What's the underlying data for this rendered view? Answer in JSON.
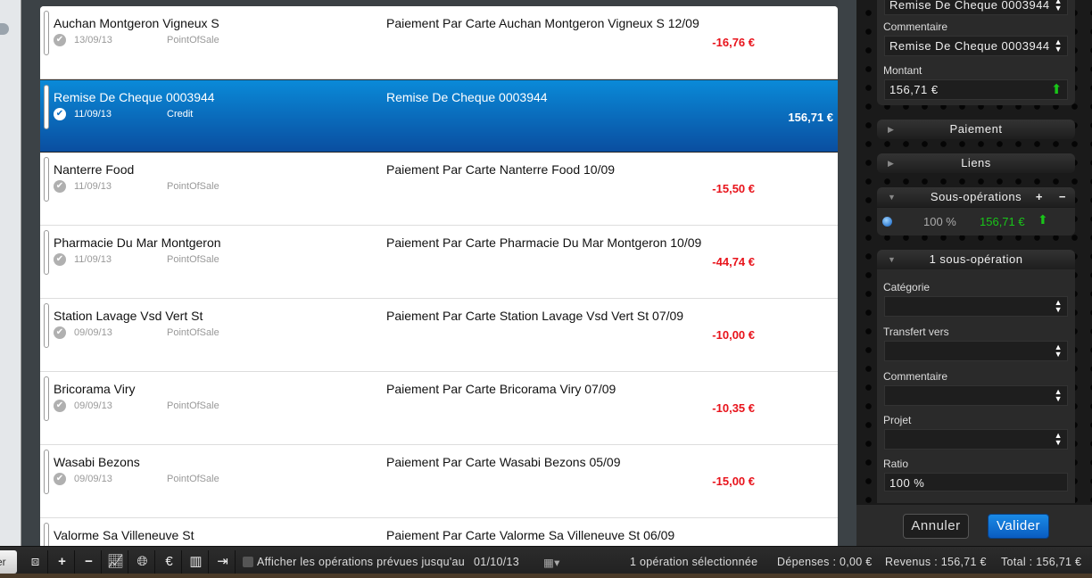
{
  "operations": [
    {
      "name": "Auchan Montgeron Vigneux S",
      "date": "13/09/13",
      "type": "PointOfSale",
      "description": "Paiement Par Carte Auchan Montgeron Vigneux S 12/09",
      "amount": "-16,76 €"
    },
    {
      "name": "Remise De Cheque 0003944",
      "date": "11/09/13",
      "type": "Credit",
      "description": "Remise De Cheque 0003944",
      "amount": "156,71 €",
      "selected": true
    },
    {
      "name": "Nanterre Food",
      "date": "11/09/13",
      "type": "PointOfSale",
      "description": "Paiement Par Carte Nanterre Food 10/09",
      "amount": "-15,50 €"
    },
    {
      "name": "Pharmacie Du Mar Montgeron",
      "date": "11/09/13",
      "type": "PointOfSale",
      "description": "Paiement Par Carte Pharmacie Du Mar Montgeron 10/09",
      "amount": "-44,74 €"
    },
    {
      "name": "Station Lavage Vsd Vert St",
      "date": "09/09/13",
      "type": "PointOfSale",
      "description": "Paiement Par Carte Station Lavage Vsd Vert St 07/09",
      "amount": "-10,00 €"
    },
    {
      "name": "Bricorama Viry",
      "date": "09/09/13",
      "type": "PointOfSale",
      "description": "Paiement Par Carte Bricorama Viry 07/09",
      "amount": "-10,35 €"
    },
    {
      "name": "Wasabi Bezons",
      "date": "09/09/13",
      "type": "PointOfSale",
      "description": "Paiement Par Carte Wasabi Bezons 05/09",
      "amount": "-15,00 €"
    },
    {
      "name": "Valorme Sa Villeneuve St",
      "date": "",
      "type": "",
      "description": "Paiement Par Carte Valorme Sa Villeneuve St 06/09",
      "amount": ""
    }
  ],
  "detail": {
    "top_field": "Remise De Cheque 0003944",
    "commentaire_label": "Commentaire",
    "commentaire_value": "Remise De Cheque 0003944",
    "montant_label": "Montant",
    "montant_value": "156,71 €",
    "paiement": "Paiement",
    "liens": "Liens",
    "sous_operations": "Sous-opérations",
    "sub_ratio": "100 %",
    "sub_amount": "156,71 €",
    "sub_header": "1 sous-opération",
    "categorie_label": "Catégorie",
    "transfert_label": "Transfert vers",
    "commentaire2_label": "Commentaire",
    "projet_label": "Projet",
    "ratio_label": "Ratio",
    "ratio_value": "100 %",
    "cancel": "Annuler",
    "validate": "Valider"
  },
  "bottom": {
    "left_button": "er",
    "show_planned_label": "Afficher les opérations prévues jusqu'au",
    "planned_date": "01/10/13",
    "selected": "1 opération sélectionnée",
    "depenses": "Dépenses : 0,00 €",
    "revenus": "Revenus : 156,71 €",
    "total": "Total : 156,71 €"
  },
  "colors": {
    "negative": "#e8131b",
    "positive": "#19c519",
    "selection": "#0a6cc0"
  }
}
